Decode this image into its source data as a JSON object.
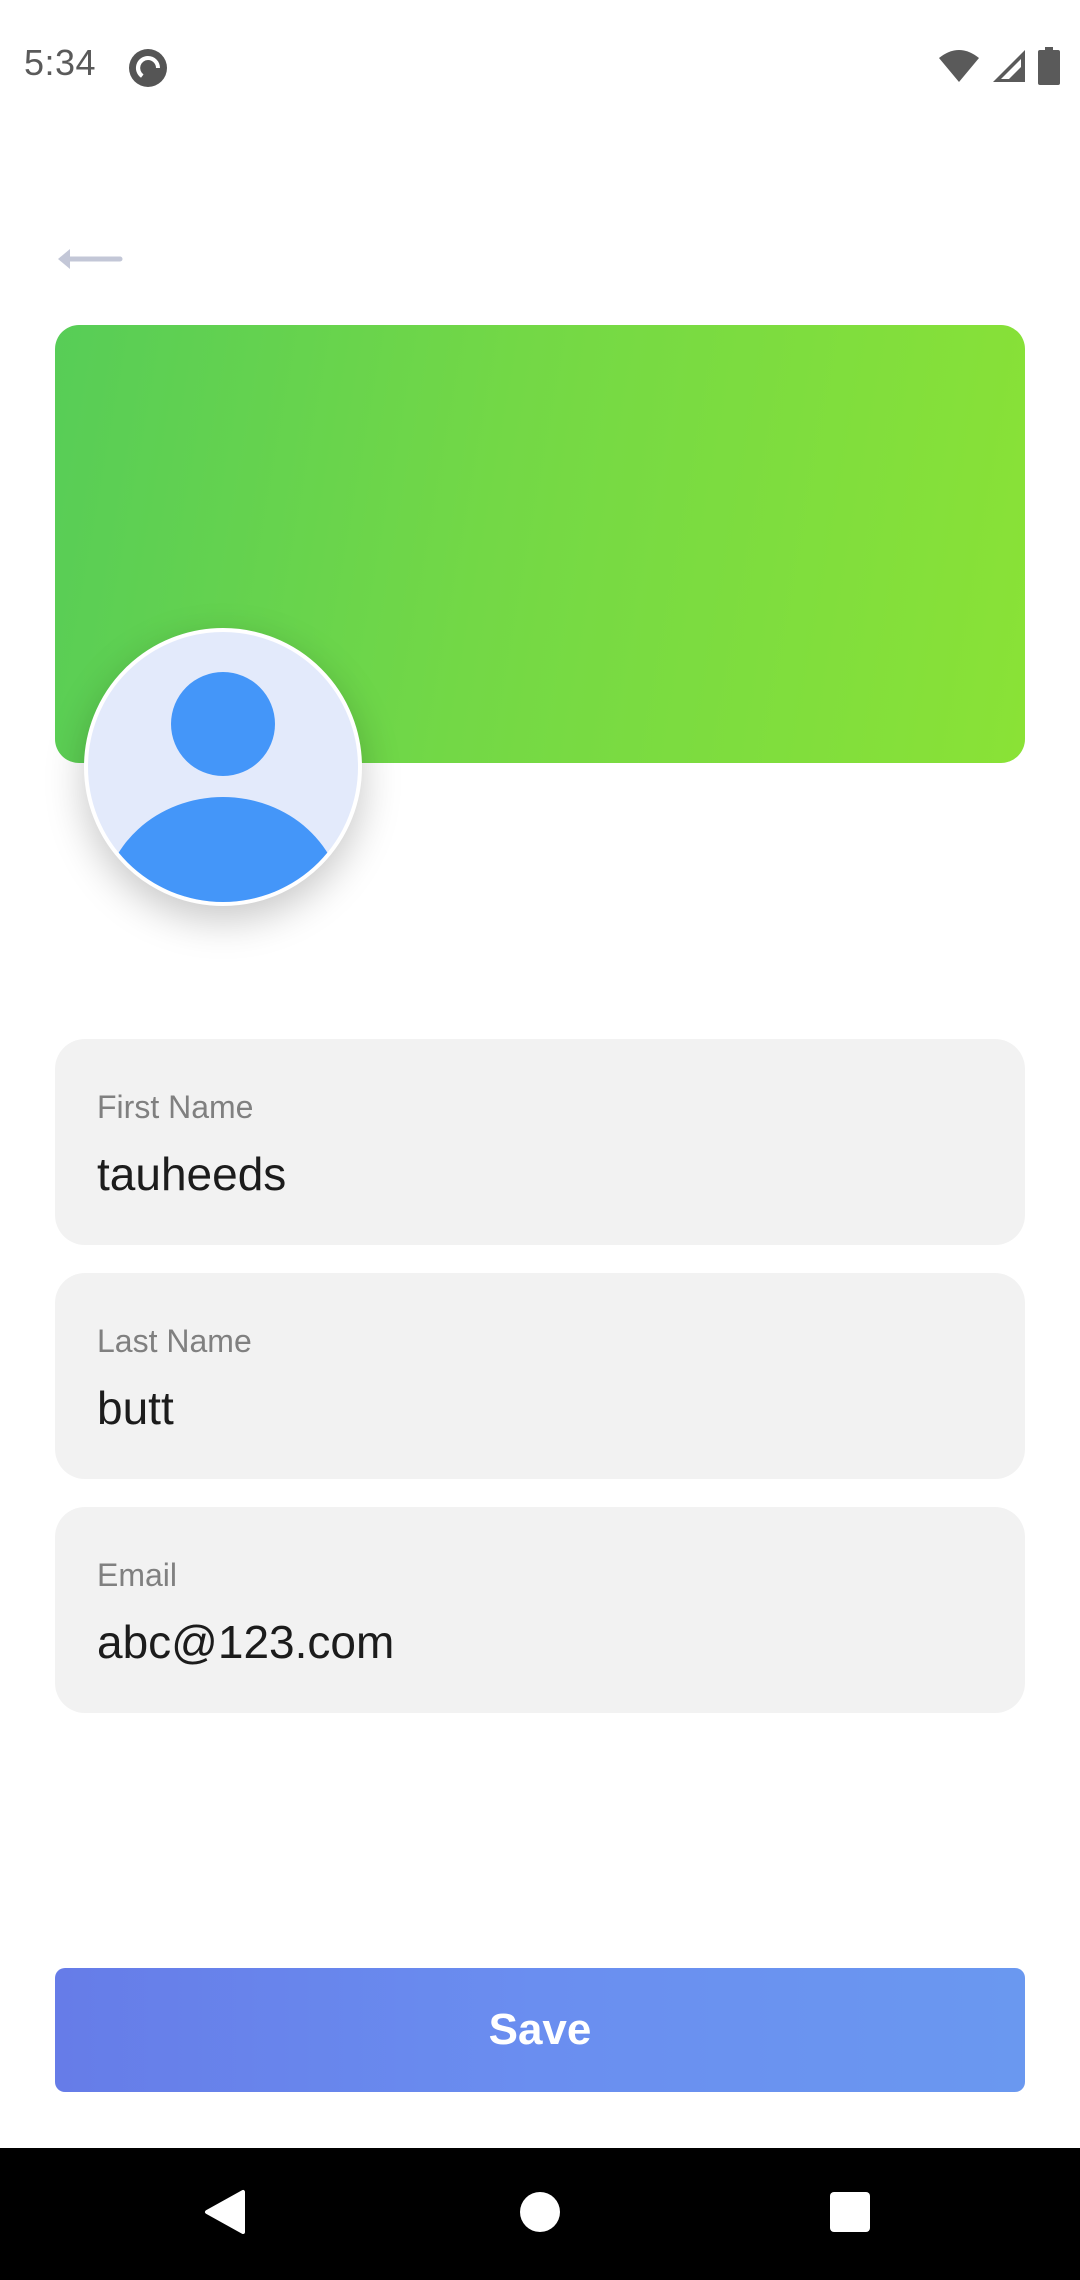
{
  "status_bar": {
    "time": "5:34",
    "app_icon": "pocket-casts-icon",
    "icons": [
      "wifi-icon",
      "cellular-signal-icon",
      "battery-icon"
    ]
  },
  "header": {
    "back_icon": "arrow-left-icon"
  },
  "banner": {
    "colors": [
      "#57cd57",
      "#8ae236"
    ]
  },
  "avatar": {
    "icon": "default-user-avatar-icon",
    "colors": {
      "background": "#e3eafb",
      "figure": "#4496f9"
    }
  },
  "form": {
    "first_name": {
      "label": "First Name",
      "value": "tauheeds"
    },
    "last_name": {
      "label": "Last Name",
      "value": "butt"
    },
    "email": {
      "label": "Email",
      "value": "abc@123.com"
    }
  },
  "save_button": {
    "label": "Save",
    "colors": [
      "#667ce8",
      "#6a98f0"
    ]
  },
  "nav_bar": {
    "icons": [
      "back-triangle-icon",
      "home-circle-icon",
      "recents-square-icon"
    ]
  }
}
